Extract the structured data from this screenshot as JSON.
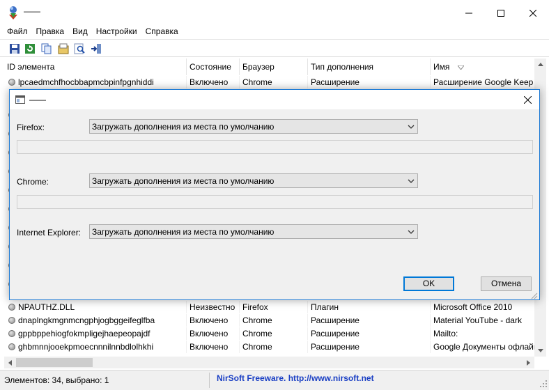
{
  "window": {
    "title": "——"
  },
  "menu": {
    "items": [
      "Файл",
      "Правка",
      "Вид",
      "Настройки",
      "Справка"
    ]
  },
  "toolbar": {
    "icons": [
      "save-icon",
      "refresh-icon",
      "copy-icon",
      "properties-icon",
      "find-icon",
      "exit-icon"
    ]
  },
  "table": {
    "columns": [
      "ID элемента",
      "Состояние",
      "Браузер",
      "Тип дополнения",
      "Имя"
    ],
    "rows_top": [
      {
        "id": "lpcaedmchfhocbbapmcbpinfpgnhiddi",
        "state": "Включено",
        "browser": "Chrome",
        "type": "Расширение",
        "name": "Расширение Google Keep"
      }
    ],
    "rows_bottom": [
      {
        "id": "NPAUTHZ.DLL",
        "state": "Неизвестно",
        "browser": "Firefox",
        "type": "Плагин",
        "name": "Microsoft Office 2010"
      },
      {
        "id": "dnaplngkmgnmcngphjogbggeifeglfba",
        "state": "Включено",
        "browser": "Chrome",
        "type": "Расширение",
        "name": "Material YouTube - dark"
      },
      {
        "id": "gppbppehiogfokmpligejhaepeopajdf",
        "state": "Включено",
        "browser": "Chrome",
        "type": "Расширение",
        "name": "Mailto:"
      },
      {
        "id": "ghbmnnjooekpmoecnnnilnnbdlolhkhi",
        "state": "Включено",
        "browser": "Chrome",
        "type": "Расширение",
        "name": "Google Документы офлайн"
      }
    ]
  },
  "status": {
    "count": "Элементов: 34, выбрано: 1",
    "link": "NirSoft Freeware.  http://www.nirsoft.net"
  },
  "dialog": {
    "title": "——",
    "firefox_label": "Firefox:",
    "chrome_label": "Chrome:",
    "ie_label": "Internet Explorer:",
    "combo_value": "Загружать дополнения из места по умолчанию",
    "ok_label": "OK",
    "cancel_label": "Отмена"
  },
  "colors": {
    "accent": "#0078d7",
    "dialog_border": "#1e7ad4",
    "link": "#1a3fc4"
  }
}
